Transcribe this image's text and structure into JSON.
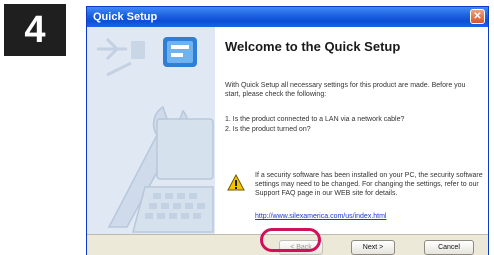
{
  "step": {
    "number": "4"
  },
  "window": {
    "title": "Quick Setup",
    "close_glyph": "✕"
  },
  "sidebar": {
    "illustration": "setup-tools-illustration-icon"
  },
  "content": {
    "heading": "Welcome to the Quick Setup",
    "intro": "With Quick Setup all necessary settings for this product are made. Before you start, please check the following:",
    "checklist": [
      "1. Is the product connected to a LAN via a network cable?",
      "2. Is the product turned on?"
    ],
    "warning": {
      "icon": "warning-icon",
      "text": "If a security software has been installed on your PC, the security software settings may need to be changed. For changing the settings, refer to our Support FAQ page in our WEB site for details."
    },
    "link": "http://www.silexamerica.com/us/index.html"
  },
  "buttons": {
    "back": "< Back",
    "next": "Next >",
    "cancel": "Cancel"
  },
  "colors": {
    "titlebar": "#0b4fd6",
    "highlight": "#d0115a",
    "sidebar": "#dfe8f3"
  }
}
